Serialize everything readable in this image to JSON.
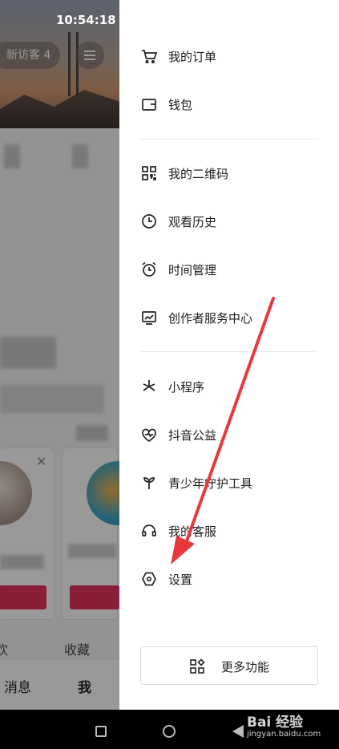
{
  "status_bar": {
    "time": "10:54:18"
  },
  "background": {
    "visitor_badge": "新访客 4",
    "tabs": [
      "欢",
      "收藏"
    ],
    "bottom_nav": [
      "消息",
      "我"
    ]
  },
  "drawer": {
    "group1": [
      {
        "label": "我的订单",
        "icon": "cart-icon"
      },
      {
        "label": "钱包",
        "icon": "wallet-icon"
      }
    ],
    "group2": [
      {
        "label": "我的二维码",
        "icon": "qrcode-icon"
      },
      {
        "label": "观看历史",
        "icon": "clock-icon"
      },
      {
        "label": "时间管理",
        "icon": "alarm-clock-icon"
      },
      {
        "label": "创作者服务中心",
        "icon": "chart-monitor-icon"
      }
    ],
    "group3": [
      {
        "label": "小程序",
        "icon": "asterisk-icon"
      },
      {
        "label": "抖音公益",
        "icon": "heart-wave-icon"
      },
      {
        "label": "青少年守护工具",
        "icon": "sprout-icon"
      },
      {
        "label": "我的客服",
        "icon": "headset-icon"
      },
      {
        "label": "设置",
        "icon": "hexagon-gear-icon"
      }
    ],
    "more_button": {
      "label": "更多功能",
      "icon": "grid-icon"
    }
  },
  "watermark": {
    "main": "Bai 经验",
    "sub": "jingyan.baidu.com"
  },
  "colors": {
    "accent_red": "#e6325a",
    "annotation_arrow": "#e8383d"
  }
}
